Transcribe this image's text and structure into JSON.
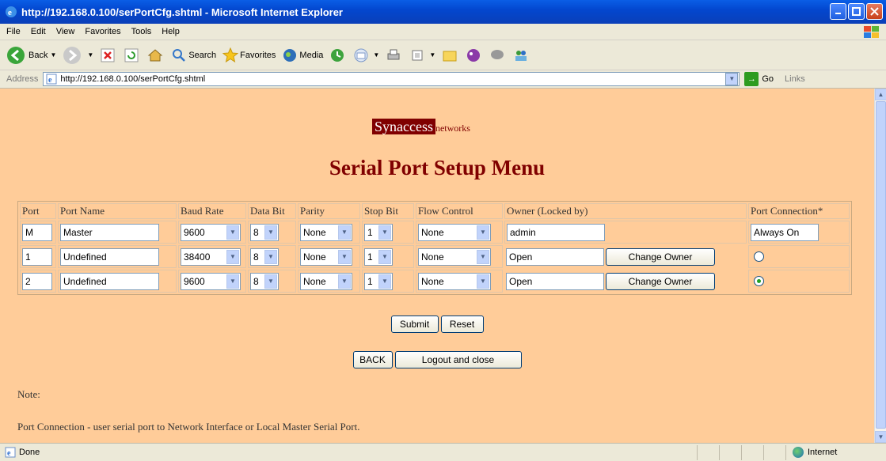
{
  "window": {
    "title": "http://192.168.0.100/serPortCfg.shtml - Microsoft Internet Explorer"
  },
  "menu": [
    "File",
    "Edit",
    "View",
    "Favorites",
    "Tools",
    "Help"
  ],
  "toolbar": {
    "back": "Back",
    "search": "Search",
    "favorites": "Favorites",
    "media": "Media"
  },
  "address": {
    "label": "Address",
    "url": "http://192.168.0.100/serPortCfg.shtml",
    "go": "Go",
    "links": "Links"
  },
  "brand": {
    "name": "Synaccess",
    "suffix": "networks"
  },
  "page": {
    "heading": "Serial Port Setup Menu"
  },
  "table": {
    "headers": [
      "Port",
      "Port Name",
      "Baud Rate",
      "Data Bit",
      "Parity",
      "Stop Bit",
      "Flow Control",
      "Owner (Locked by)",
      "Port Connection*"
    ],
    "rows": [
      {
        "port": "M",
        "name": "Master",
        "baud": "9600",
        "data_bit": "8",
        "parity": "None",
        "stop_bit": "1",
        "flow": "None",
        "owner": "admin",
        "connection": "Always On"
      },
      {
        "port": "1",
        "name": "Undefined",
        "baud": "38400",
        "data_bit": "8",
        "parity": "None",
        "stop_bit": "1",
        "flow": "None",
        "owner": "Open",
        "change_owner": "Change Owner",
        "connection_selected": false
      },
      {
        "port": "2",
        "name": "Undefined",
        "baud": "9600",
        "data_bit": "8",
        "parity": "None",
        "stop_bit": "1",
        "flow": "None",
        "owner": "Open",
        "change_owner": "Change Owner",
        "connection_selected": true
      }
    ]
  },
  "buttons": {
    "submit": "Submit",
    "reset": "Reset",
    "back": "BACK",
    "logout": "Logout and close"
  },
  "note": {
    "label": "Note:",
    "text": "Port Connection - user serial port to Network Interface or Local Master Serial Port."
  },
  "status": {
    "text": "Done",
    "zone": "Internet"
  },
  "colors": {
    "page_bg": "#ffcc99",
    "brand": "#800000",
    "titlebar": "#0347cf"
  }
}
